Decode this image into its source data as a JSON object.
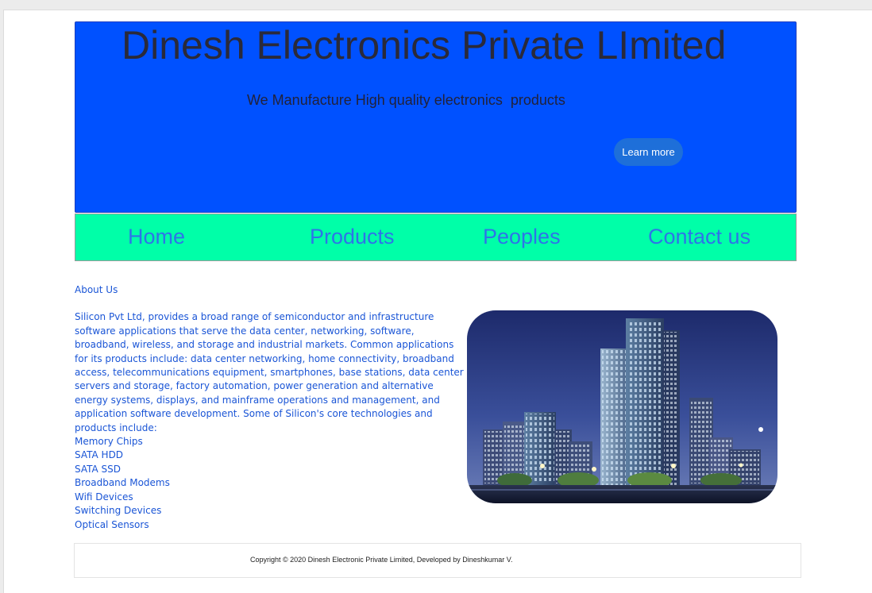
{
  "hero": {
    "title": "Dinesh Electronics Private LImited",
    "subtitle": "We Manufacture High quality electronics  products",
    "cta_label": "Learn more"
  },
  "nav": {
    "items": [
      "Home",
      "Products",
      "Peoples",
      "Contact us"
    ]
  },
  "about": {
    "heading": "About Us",
    "body": "Silicon Pvt Ltd, provides a broad range of semiconductor and infrastructure software applications that serve the data center, networking, software, broadband, wireless, and storage and industrial markets. Common applications for its products include: data center networking, home connectivity, broadband access, telecommunications equipment, smartphones, base stations, data center servers and storage, factory automation, power generation and alternative energy systems, displays, and mainframe operations and management, and application software development. Some of Silicon's core technologies and products include:",
    "products": [
      "Memory Chips",
      "SATA HDD",
      "SATA SSD",
      "Broadband Modems",
      "Wifi Devices",
      "Switching Devices",
      "Optical Sensors"
    ]
  },
  "footer": {
    "copyright": "Copyright © 2020 Dinesh Electronic Private Limited, Developed by Dineshkumar V."
  },
  "colors": {
    "hero_bg": "#0051ff",
    "nav_bg": "#00ffa8",
    "nav_link": "#2e74e8",
    "text_link": "#1a55d6",
    "cta_bg": "#1e6fd9"
  }
}
